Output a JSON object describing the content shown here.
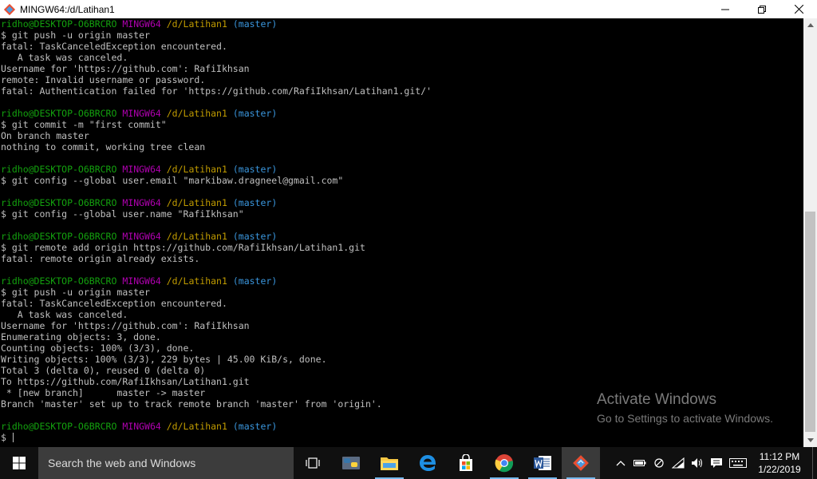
{
  "window": {
    "title": "MINGW64:/d/Latihan1"
  },
  "prompt": {
    "user": "ridho@DESKTOP-O6BRCRO",
    "system": "MINGW64",
    "path": "/d/Latihan1",
    "branch": "(master)"
  },
  "terminal": {
    "lines": [
      {
        "type": "prompt"
      },
      {
        "type": "text",
        "text": "$ git push -u origin master"
      },
      {
        "type": "text",
        "text": "fatal: TaskCanceledException encountered."
      },
      {
        "type": "text",
        "text": "   A task was canceled."
      },
      {
        "type": "text",
        "text": "Username for 'https://github.com': RafiIkhsan"
      },
      {
        "type": "text",
        "text": "remote: Invalid username or password."
      },
      {
        "type": "text",
        "text": "fatal: Authentication failed for 'https://github.com/RafiIkhsan/Latihan1.git/'"
      },
      {
        "type": "text",
        "text": ""
      },
      {
        "type": "prompt"
      },
      {
        "type": "text",
        "text": "$ git commit -m \"first commit\""
      },
      {
        "type": "text",
        "text": "On branch master"
      },
      {
        "type": "text",
        "text": "nothing to commit, working tree clean"
      },
      {
        "type": "text",
        "text": ""
      },
      {
        "type": "prompt"
      },
      {
        "type": "text",
        "text": "$ git config --global user.email \"markibaw.dragneel@gmail.com\""
      },
      {
        "type": "text",
        "text": ""
      },
      {
        "type": "prompt"
      },
      {
        "type": "text",
        "text": "$ git config --global user.name \"RafiIkhsan\""
      },
      {
        "type": "text",
        "text": ""
      },
      {
        "type": "prompt"
      },
      {
        "type": "text",
        "text": "$ git remote add origin https://github.com/RafiIkhsan/Latihan1.git"
      },
      {
        "type": "text",
        "text": "fatal: remote origin already exists."
      },
      {
        "type": "text",
        "text": ""
      },
      {
        "type": "prompt"
      },
      {
        "type": "text",
        "text": "$ git push -u origin master"
      },
      {
        "type": "text",
        "text": "fatal: TaskCanceledException encountered."
      },
      {
        "type": "text",
        "text": "   A task was canceled."
      },
      {
        "type": "text",
        "text": "Username for 'https://github.com': RafiIkhsan"
      },
      {
        "type": "text",
        "text": "Enumerating objects: 3, done."
      },
      {
        "type": "text",
        "text": "Counting objects: 100% (3/3), done."
      },
      {
        "type": "text",
        "text": "Writing objects: 100% (3/3), 229 bytes | 45.00 KiB/s, done."
      },
      {
        "type": "text",
        "text": "Total 3 (delta 0), reused 0 (delta 0)"
      },
      {
        "type": "text",
        "text": "To https://github.com/RafiIkhsan/Latihan1.git"
      },
      {
        "type": "text",
        "text": " * [new branch]      master -> master"
      },
      {
        "type": "text",
        "text": "Branch 'master' set up to track remote branch 'master' from 'origin'."
      },
      {
        "type": "text",
        "text": ""
      },
      {
        "type": "prompt"
      },
      {
        "type": "input",
        "text": "$ "
      }
    ]
  },
  "colors": {
    "user": "#13a10e",
    "mingw": "#b000b0",
    "path": "#c19c00",
    "branch": "#3a96dd",
    "text": "#c0c0c0"
  },
  "watermark": {
    "title": "Activate Windows",
    "subtitle": "Go to Settings to activate Windows."
  },
  "taskbar": {
    "search_placeholder": "Search the web and Windows",
    "pinned": [
      {
        "name": "task-view-icon",
        "running": false,
        "active": false
      },
      {
        "name": "python-icon",
        "running": false,
        "active": false
      },
      {
        "name": "file-explorer-icon",
        "running": true,
        "active": false
      },
      {
        "name": "edge-icon",
        "running": false,
        "active": false
      },
      {
        "name": "store-icon",
        "running": false,
        "active": false
      },
      {
        "name": "chrome-icon",
        "running": true,
        "active": false
      },
      {
        "name": "word-icon",
        "running": true,
        "active": false
      },
      {
        "name": "git-bash-icon",
        "running": true,
        "active": true
      }
    ],
    "tray_icons": [
      "chevron-up-icon",
      "battery-icon",
      "disconnected-icon",
      "wifi-icon",
      "volume-icon",
      "action-center-icon",
      "keyboard-icon"
    ],
    "time": "11:12 PM",
    "date": "1/22/2019"
  }
}
